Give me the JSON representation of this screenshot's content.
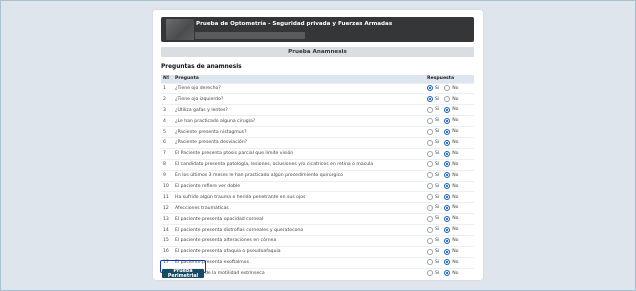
{
  "header": {
    "title": "Prueba de Optometría - Seguridad privada y Fuerzas Armadas"
  },
  "section_title": "Prueba Anamnesis",
  "subtitle": "Preguntas de anamnesis",
  "table": {
    "headers": {
      "n": "Nº",
      "question": "Pregunta",
      "answer": "Respuesta"
    },
    "yes_label": "Sí",
    "no_label": "No",
    "rows": [
      {
        "n": "1",
        "question": "¿Tiene ojo derecho?",
        "answer": "yes"
      },
      {
        "n": "2",
        "question": "¿Tiene ojo izquierdo?",
        "answer": "yes"
      },
      {
        "n": "3",
        "question": "¿Utiliza gafas y lentes?",
        "answer": "no"
      },
      {
        "n": "4",
        "question": "¿Le han practicado alguna cirugía?",
        "answer": "no"
      },
      {
        "n": "5",
        "question": "¿Paciente presenta nistagmus?",
        "answer": "no"
      },
      {
        "n": "6",
        "question": "¿Paciente presenta desviación?",
        "answer": "no"
      },
      {
        "n": "7",
        "question": "El Paciente presenta ptosis parcial que limite visión",
        "answer": "no"
      },
      {
        "n": "8",
        "question": "El candidato presenta patología, lesiones, oclusiones y/o cicatrices en retina o macula",
        "answer": "no"
      },
      {
        "n": "9",
        "question": "En los últimos 3 meses le han practicado algún procedimiento quirúrgico",
        "answer": "no"
      },
      {
        "n": "10",
        "question": "El paciente refiere ver doble",
        "answer": "no"
      },
      {
        "n": "11",
        "question": "Ha sufrido algún trauma o herida penetrante en sus ojos",
        "answer": "no"
      },
      {
        "n": "12",
        "question": "Afecciones traumáticas",
        "answer": "no"
      },
      {
        "n": "13",
        "question": "El paciente presenta opacidad corneal",
        "answer": "no"
      },
      {
        "n": "14",
        "question": "El paciente presenta distrofias corneales y queratocono",
        "answer": "no"
      },
      {
        "n": "15",
        "question": "El paciente presenta alteraciones en córnea",
        "answer": "no"
      },
      {
        "n": "16",
        "question": "El paciente presenta afaquia o pseudoafaquia",
        "answer": "no"
      },
      {
        "n": "17",
        "question": "El paciente presenta exoftalmos",
        "answer": "no"
      },
      {
        "n": "18",
        "question": "Alteraciones de la motilidad extrínseca",
        "answer": "no"
      }
    ]
  },
  "submit_label": "Prueba Perimetrial",
  "colors": {
    "accent": "#184a63",
    "header_bg": "#353638",
    "radio_on": "#1f66c8",
    "focus_ring": "#1136b8"
  }
}
